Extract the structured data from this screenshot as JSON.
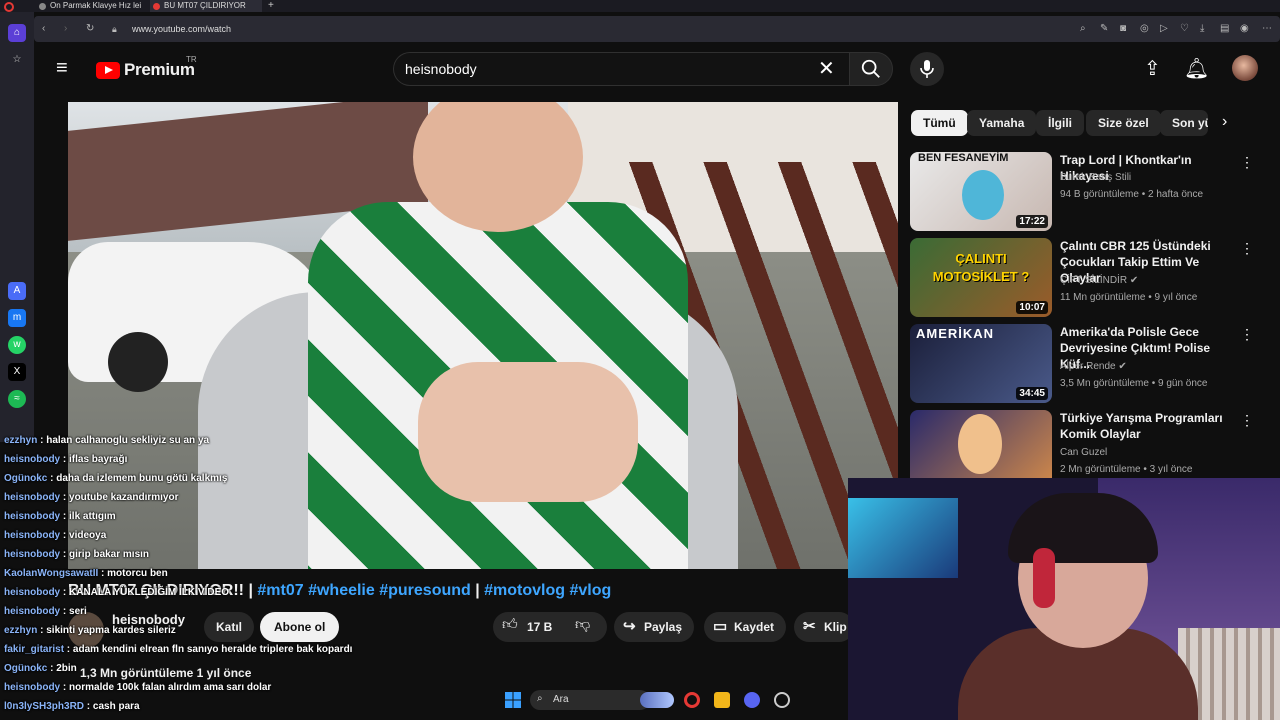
{
  "browser": {
    "tabs": [
      {
        "label": "On Parmak Klavye Hız lei"
      },
      {
        "label": "BU MT07 ÇILDIRIYOR"
      }
    ],
    "new_tab": "+",
    "url": "www.youtube.com/watch"
  },
  "youtube": {
    "logo": "Premium",
    "logo_region": "TR",
    "search_value": "heisnobody",
    "icons": {
      "menu": "hamburger-icon",
      "search": "search-icon",
      "mic": "mic-icon",
      "upload": "upload-icon",
      "bell": "bell-icon"
    }
  },
  "chips": [
    "Tümü",
    "Yamaha",
    "İlgili",
    "Size özel",
    "Son yü"
  ],
  "recommendations": [
    {
      "title": "Trap Lord | Khontkar'ın Hikayesi",
      "channel": "Burak Barış Stili",
      "meta": "94 B görüntüleme • 2 hafta önce",
      "duration": "17:22",
      "thumb_text": "BEN FESANEYİM"
    },
    {
      "title": "Çalıntı CBR 125 Üstündeki Çocukları Takip Ettim Ve Olaylar",
      "channel": "ÇİFT SİLİNDİR",
      "meta": "11 Mn görüntüleme • 9 yıl önce",
      "duration": "10:07",
      "thumb_text": "ÇALINTI MOTOSİKLET ?"
    },
    {
      "title": "Amerika'da Polisle Gece Devriyesine Çıktım! Polise Küf...",
      "channel": "Alper Rende",
      "meta": "3,5 Mn görüntüleme • 9 gün önce",
      "duration": "34:45",
      "thumb_text": "AMERİKAN"
    },
    {
      "title": "Türkiye Yarışma Programları Komik Olaylar",
      "channel": "Can Guzel",
      "meta": "2 Mn görüntüleme • 3 yıl önce",
      "duration": "",
      "thumb_text": ""
    }
  ],
  "video": {
    "title_prefix": "BU MT07 ÇILDIRIYOR!! | ",
    "tags": "#mt07 #wheelie #puresound",
    "title_mid": " | ",
    "tags2": "#motovlog #vlog",
    "channel": "heisnobody",
    "join": "Katıl",
    "subscribe": "Abone ol",
    "likes": "17 B",
    "share": "Paylaş",
    "save": "Kaydet",
    "clip": "Klip",
    "views": "1,3 Mn görüntüleme  1 yıl önce"
  },
  "chat": [
    {
      "name": "ezzhyn",
      "msg": " : halan calhanoglu sekliyiz su an ya"
    },
    {
      "name": "heisnobody",
      "msg": " : iflas bayrağı"
    },
    {
      "name": "Ogünokc",
      "msg": " : daha da izlemem bunu götü kalkmış"
    },
    {
      "name": "heisnobody",
      "msg": " : youtube kazandırmıyor"
    },
    {
      "name": "heisnobody",
      "msg": " : ilk attıgım"
    },
    {
      "name": "heisnobody",
      "msg": " : videoya"
    },
    {
      "name": "heisnobody",
      "msg": " : girip bakar mısın"
    },
    {
      "name": "KaolanWongsawatII",
      "msg": " : motorcu ben"
    },
    {
      "name": "heisnobody",
      "msg": " : KANALA YÜKLEDİĞİM İLK VİDEO"
    },
    {
      "name": "heisnobody",
      "msg": " : seri"
    },
    {
      "name": "ezzhyn",
      "msg": " : sikinti yapma kardes sileriz"
    },
    {
      "name": "fakir_gitarist",
      "msg": " : adam kendini elrean fln sanıyo heralde triplere bak kopardı"
    },
    {
      "name": "Ogünokc",
      "msg": " : 2bin"
    },
    {
      "name": "heisnobody",
      "msg": " : normalde 100k falan alırdım ama sarı dolar"
    },
    {
      "name": "l0n3lySH3ph3RD",
      "msg": " : cash para"
    }
  ],
  "taskbar": {
    "search": "Ara"
  },
  "colors": {
    "accent": "#ff0000",
    "link": "#3ea6ff",
    "chat_name": "#8ab4f8"
  }
}
